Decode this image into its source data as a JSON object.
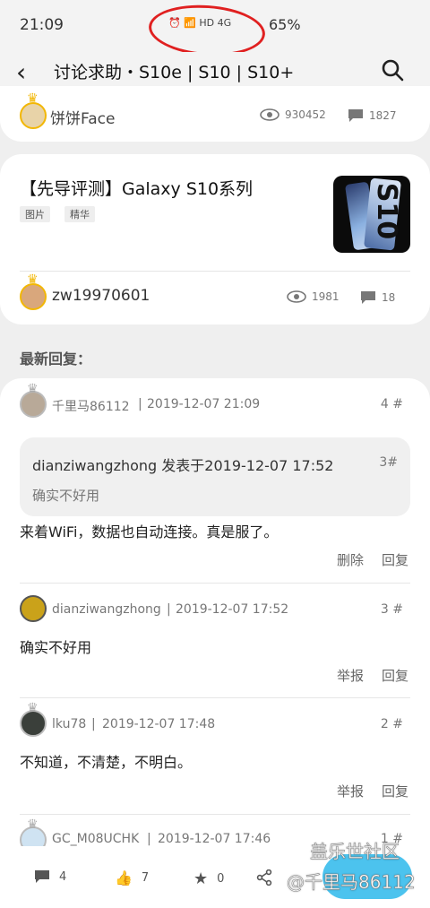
{
  "status_bar": {
    "time": "21:09",
    "indicators": "HD  4G",
    "battery": "65%"
  },
  "top_bar": {
    "title": "讨论求助・S10e | S10 | S10+"
  },
  "prev_post": {
    "author": "饼饼Face",
    "views": "930452",
    "comments": "1827"
  },
  "post": {
    "title": "【先导评测】Galaxy S10系列",
    "tags": [
      "图片",
      "精华"
    ],
    "thumbnail_text": "S10",
    "author": "zw19970601",
    "views": "1981",
    "comments": "18"
  },
  "latest_replies_label": "最新回复：",
  "replies": [
    {
      "user": "千里马86112",
      "time": "2019-12-07 21:09",
      "floor": "4 #",
      "quote": {
        "header": "dianziwangzhong 发表于2019-12-07 17:52",
        "floor": "3#",
        "text": "确实不好用"
      },
      "text": "来着WiFi，数据也自动连接。真是服了。",
      "actions": [
        "删除",
        "回复"
      ]
    },
    {
      "user": "dianziwangzhong",
      "time": "2019-12-07 17:52",
      "floor": "3 #",
      "text": "确实不好用",
      "actions": [
        "举报",
        "回复"
      ]
    },
    {
      "user": "lku78",
      "time": "2019-12-07 17:48",
      "floor": "2 #",
      "text": "不知道，不清楚，不明白。",
      "actions": [
        "举报",
        "回复"
      ]
    },
    {
      "user": "GC_M08UCHK",
      "time": "2019-12-07 17:46",
      "floor": "1 #"
    }
  ],
  "bottom_bar": {
    "comments": "4",
    "likes": "7",
    "favorites": "0"
  },
  "watermark": {
    "line1": "盖乐世社区",
    "line2": "@千里马86112"
  },
  "colors": {
    "accent": "#4cc3ee",
    "annotation": "#e02020",
    "crown": "#f2b705"
  }
}
